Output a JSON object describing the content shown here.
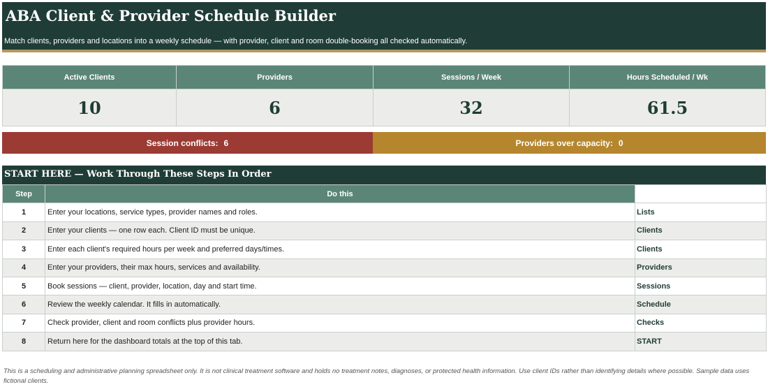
{
  "header": {
    "title": "ABA Client & Provider Schedule Builder",
    "subtitle": "Match clients, providers and locations into a weekly schedule — with provider, client and room double-booking all checked automatically."
  },
  "kpis": [
    {
      "label": "Active Clients",
      "value": "10"
    },
    {
      "label": "Providers",
      "value": "6"
    },
    {
      "label": "Sessions / Week",
      "value": "32"
    },
    {
      "label": "Hours Scheduled / Wk",
      "value": "61.5"
    }
  ],
  "status": {
    "conflicts_label": "Session conflicts:",
    "conflicts_value": "6",
    "capacity_label": "Providers over capacity:",
    "capacity_value": "0"
  },
  "steps": {
    "title": "START HERE — Work Through These Steps In Order",
    "col_step": "Step",
    "col_do": "Do this",
    "rows": [
      {
        "step": "1",
        "text": "Enter your locations, service types, provider names and roles.",
        "tab": "Lists"
      },
      {
        "step": "2",
        "text": "Enter your clients — one row each. Client ID must be unique.",
        "tab": "Clients"
      },
      {
        "step": "3",
        "text": "Enter each client's required hours per week and preferred days/times.",
        "tab": "Clients"
      },
      {
        "step": "4",
        "text": "Enter your providers, their max hours, services and availability.",
        "tab": "Providers"
      },
      {
        "step": "5",
        "text": "Book sessions — client, provider, location, day and start time.",
        "tab": "Sessions"
      },
      {
        "step": "6",
        "text": "Review the weekly calendar. It fills in automatically.",
        "tab": "Schedule"
      },
      {
        "step": "7",
        "text": "Check provider, client and room conflicts plus provider hours.",
        "tab": "Checks"
      },
      {
        "step": "8",
        "text": "Return here for the dashboard totals at the top of this tab.",
        "tab": "START"
      }
    ]
  },
  "footnote": "This is a scheduling and administrative planning spreadsheet only. It is not clinical treatment software and holds no treatment notes, diagnoses, or protected health information. Use client IDs rather than identifying details where possible. Sample data uses fictional clients."
}
